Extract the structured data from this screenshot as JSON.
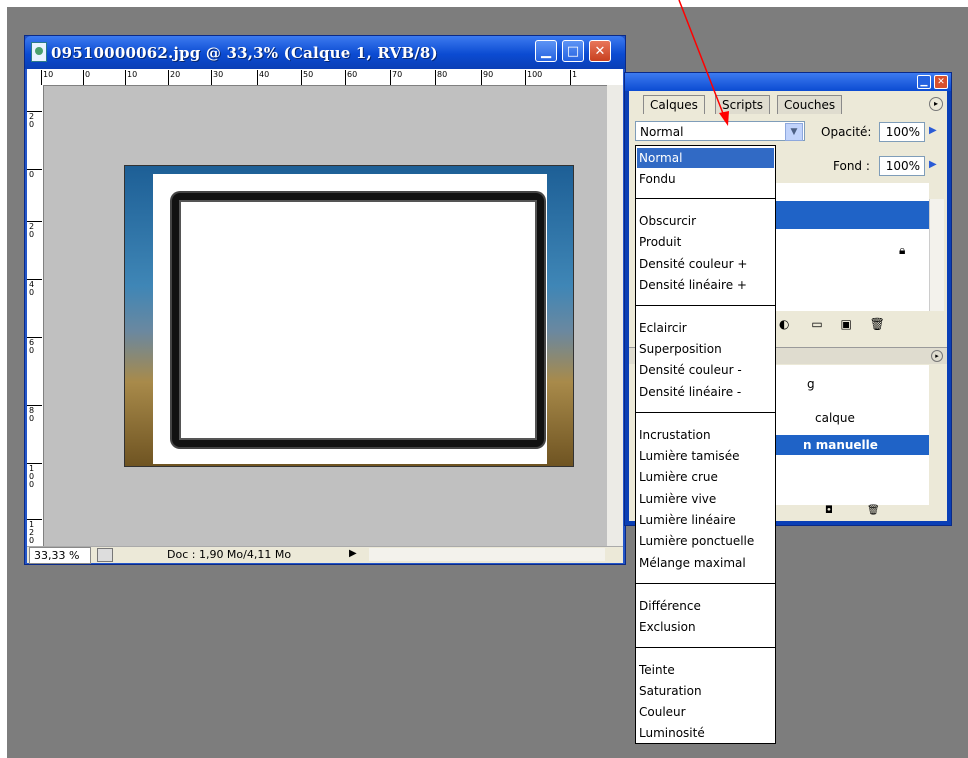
{
  "document_window": {
    "title": "09510000062.jpg @ 33,3% (Calque 1, RVB/8)",
    "ruler_top_labels": [
      "10",
      "0",
      "10",
      "20",
      "30",
      "40",
      "50",
      "60",
      "70",
      "80",
      "90",
      "100",
      "1"
    ],
    "ruler_left_labels": [
      "20",
      "0",
      "20",
      "40",
      "60",
      "80",
      "100",
      "120"
    ],
    "zoom": "33,33 %",
    "doc_info": "Doc : 1,90 Mo/4,11 Mo"
  },
  "layers_panel": {
    "tabs": [
      "Calques",
      "Scripts",
      "Couches"
    ],
    "blend_mode": "Normal",
    "opacity_label": "Opacité:",
    "opacity_value": "100%",
    "fill_label": "Fond :",
    "fill_value": "100%"
  },
  "history_panel": {
    "items": [
      "g",
      "calque",
      "n manuelle"
    ]
  },
  "blend_dropdown": {
    "groups": [
      [
        "Normal",
        "Fondu"
      ],
      [
        "Obscurcir",
        "Produit",
        "Densité couleur +",
        "Densité linéaire +"
      ],
      [
        "Eclaircir",
        "Superposition",
        "Densité couleur -",
        "Densité linéaire -"
      ],
      [
        "Incrustation",
        "Lumière tamisée",
        "Lumière crue",
        "Lumière vive",
        "Lumière linéaire",
        "Lumière ponctuelle",
        "Mélange maximal"
      ],
      [
        "Différence",
        "Exclusion"
      ],
      [
        "Teinte",
        "Saturation",
        "Couleur",
        "Luminosité"
      ]
    ],
    "selected": "Normal"
  },
  "colors": {
    "desktop": "#7d7d7d",
    "titlebar": "#0b4bd2",
    "selection": "#316ac5",
    "annotation_arrow": "#ff0000"
  }
}
